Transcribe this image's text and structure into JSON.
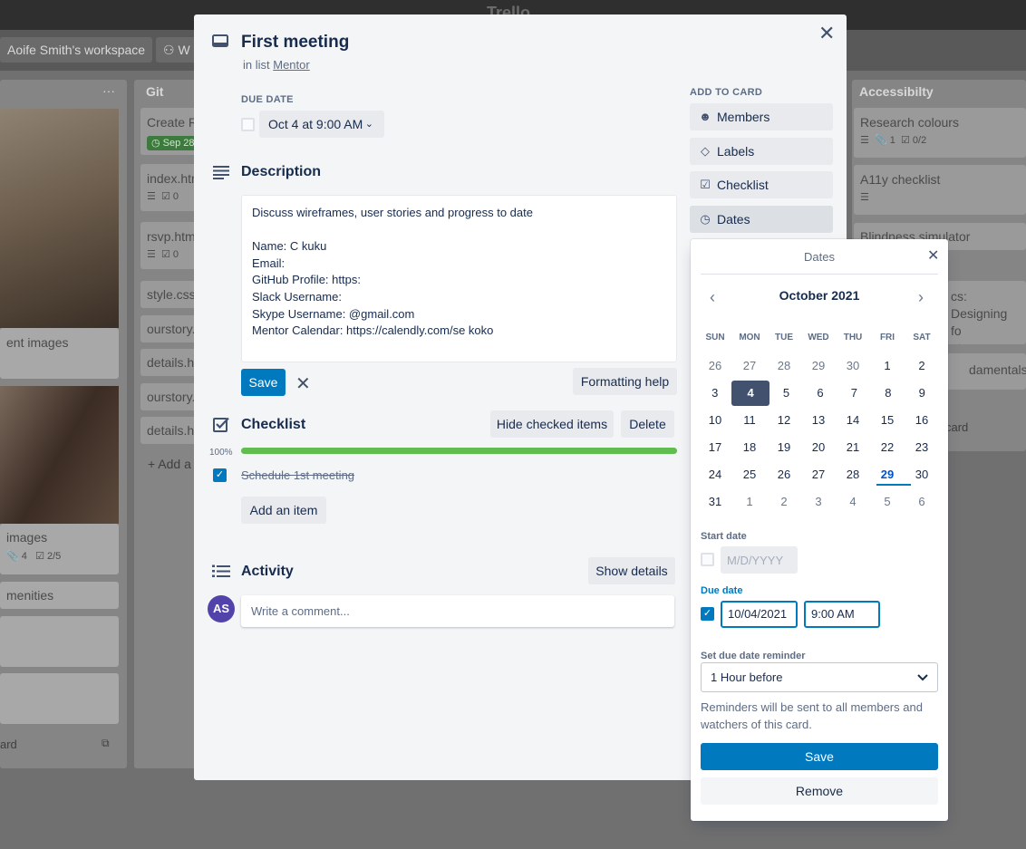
{
  "app": {
    "logo": "Trello"
  },
  "board": {
    "workspace_label": "Aoife Smith's workspace",
    "board_btn2": "W",
    "lists": {
      "left": {
        "more": "···",
        "cards": [
          {
            "title": "ent images"
          },
          {
            "title": " images",
            "attachments": "4",
            "checklist": "2/5"
          },
          {
            "title": "menities"
          }
        ],
        "add_card": "ard"
      },
      "git": {
        "title": "Git",
        "cards": [
          {
            "title": "Create Re",
            "badge": "Sep 28"
          },
          {
            "title": "index.htm",
            "count": "0"
          },
          {
            "title": "rsvp.html",
            "count": "0"
          },
          {
            "title": "style.css"
          },
          {
            "title": "ourstory."
          },
          {
            "title": "details.ht"
          },
          {
            "title": "ourstory."
          },
          {
            "title": "details.ht"
          }
        ],
        "add_card": "+ Add a"
      },
      "access": {
        "title": "Accessibilty",
        "cards": [
          {
            "title": "Research colours",
            "attachments": "1",
            "checklist": "0/2"
          },
          {
            "title": "A11y checklist"
          },
          {
            "title": "Blindness simulator"
          },
          {
            "title": "cs: Designing fo"
          },
          {
            "title": "nt"
          },
          {
            "title": "damentals"
          }
        ],
        "add_card": "card"
      }
    }
  },
  "card": {
    "title": "First meeting",
    "in_list_prefix": "in list",
    "list_name": "Mentor",
    "due_date_label": "DUE DATE",
    "due_date_value": "Oct 4 at 9:00 AM",
    "description_label": "Description",
    "description_lines": [
      "Discuss wireframes, user stories and progress to date",
      "",
      "Name: C          kuku",
      "Email: ",
      "GitHub Profile: https:",
      "Slack Username:",
      "Skype Username:            @gmail.com",
      "Mentor Calendar: https://calendly.com/se       koko"
    ],
    "save_label": "Save",
    "formatting_help": "Formatting help",
    "checklist_label": "Checklist",
    "hide_checked": "Hide checked items",
    "delete_label": "Delete",
    "progress_text": "100%",
    "progress_value": 1.0,
    "checklist_items": [
      {
        "text": "Schedule 1st meeting",
        "checked": true
      }
    ],
    "add_item": "Add an item",
    "activity_label": "Activity",
    "show_details": "Show details",
    "avatar_initials": "AS",
    "comment_placeholder": "Write a comment..."
  },
  "sidebar": {
    "heading": "ADD TO CARD",
    "buttons": [
      {
        "label": "Members",
        "icon": "person-icon"
      },
      {
        "label": "Labels",
        "icon": "tag-icon"
      },
      {
        "label": "Checklist",
        "icon": "checkbox-icon"
      },
      {
        "label": "Dates",
        "icon": "clock-icon"
      }
    ]
  },
  "dates_popover": {
    "title": "Dates",
    "month": "October 2021",
    "weekdays": [
      "SUN",
      "MON",
      "TUE",
      "WED",
      "THU",
      "FRI",
      "SAT"
    ],
    "weeks": [
      [
        "26",
        "27",
        "28",
        "29",
        "30",
        "1",
        "2"
      ],
      [
        "3",
        "4",
        "5",
        "6",
        "7",
        "8",
        "9"
      ],
      [
        "10",
        "11",
        "12",
        "13",
        "14",
        "15",
        "16"
      ],
      [
        "17",
        "18",
        "19",
        "20",
        "21",
        "22",
        "23"
      ],
      [
        "24",
        "25",
        "26",
        "27",
        "28",
        "29",
        "30"
      ],
      [
        "31",
        "1",
        "2",
        "3",
        "4",
        "5",
        "6"
      ]
    ],
    "today": "29",
    "selected": "4",
    "start_date_label": "Start date",
    "start_date_placeholder": "M/D/YYYY",
    "due_date_label": "Due date",
    "due_date_value": "10/04/2021",
    "due_time_value": "9:00 AM",
    "reminder_label": "Set due date reminder",
    "reminder_value": "1 Hour before",
    "reminder_note": "Reminders will be sent to all members and watchers of this card.",
    "save_label": "Save",
    "remove_label": "Remove"
  }
}
